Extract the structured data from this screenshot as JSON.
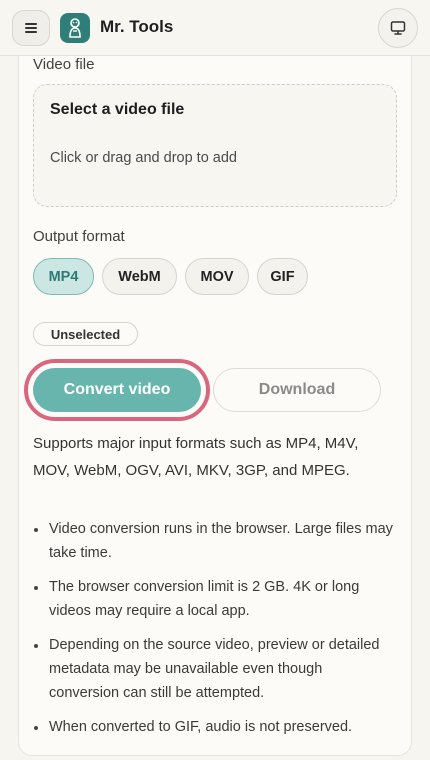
{
  "header": {
    "brand": "Mr. Tools",
    "menu_icon": "hamburger-menu-icon",
    "logo_icon": "mascot-logo-icon",
    "display_icon": "monitor-icon"
  },
  "video_file": {
    "label": "Video file",
    "dropzone_title": "Select a video file",
    "dropzone_hint": "Click or drag and drop to add"
  },
  "output_format": {
    "label": "Output format",
    "options": [
      "MP4",
      "WebM",
      "MOV",
      "GIF"
    ],
    "selected": "MP4"
  },
  "status": "Unselected",
  "actions": {
    "convert_label": "Convert video",
    "download_label": "Download"
  },
  "description": "Supports major input formats such as MP4, M4V, MOV, WebM, OGV, AVI, MKV, 3GP, and MPEG.",
  "notes": [
    "Video conversion runs in the browser. Large files may take time.",
    "The browser conversion limit is 2 GB. 4K or long videos may require a local app.",
    "Depending on the source video, preview or detailed metadata may be unavailable even though conversion can still be attempted.",
    "When converted to GIF, audio is not preserved."
  ],
  "colors": {
    "accent": "#68b5ae",
    "accent_selected_bg": "#cbe6e3",
    "focus_ring": "#d9667f",
    "logo_bg": "#2f7f78"
  }
}
